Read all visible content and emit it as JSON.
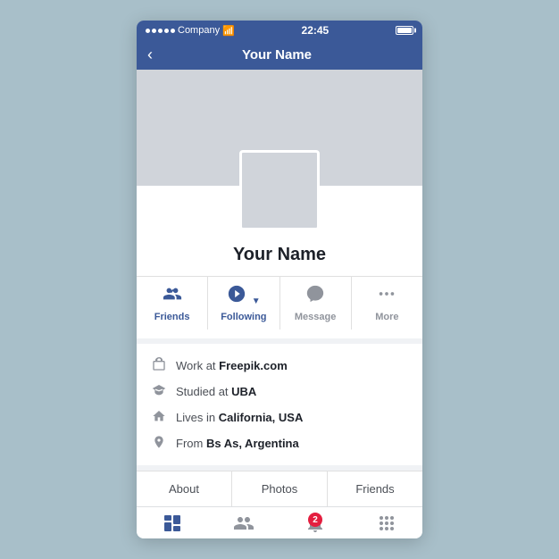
{
  "statusBar": {
    "carrier": "Company",
    "time": "22:45"
  },
  "navBar": {
    "title": "Your Name",
    "backLabel": "<"
  },
  "profile": {
    "name": "Your Name"
  },
  "actions": {
    "friends": "Friends",
    "following": "Following",
    "message": "Message",
    "more": "More"
  },
  "info": [
    {
      "icon": "work",
      "text": "Work at ",
      "bold": "Freepik.com"
    },
    {
      "icon": "study",
      "text": "Studied at ",
      "bold": "UBA"
    },
    {
      "icon": "home",
      "text": "Lives in ",
      "bold": "California, USA"
    },
    {
      "icon": "location",
      "text": "From ",
      "bold": "Bs As, Argentina"
    }
  ],
  "tabs": [
    "About",
    "Photos",
    "Friends"
  ],
  "bottomNav": {
    "notifCount": "2"
  }
}
